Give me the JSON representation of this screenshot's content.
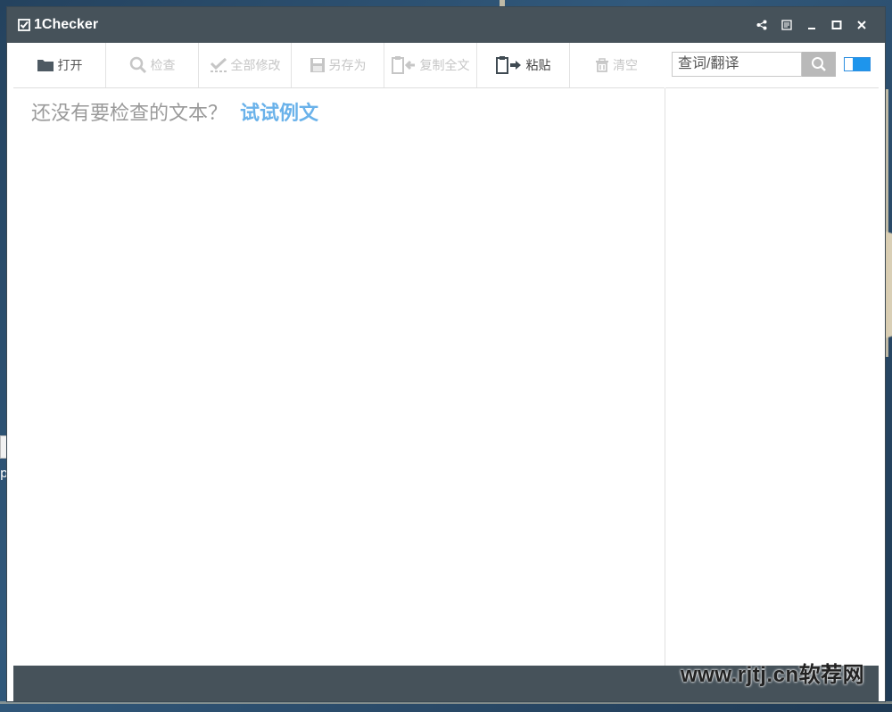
{
  "window": {
    "title": "1Checker",
    "app_icon": "checkbox-icon"
  },
  "titlebar_buttons": [
    {
      "name": "share-icon"
    },
    {
      "name": "feedback-icon"
    },
    {
      "name": "minimize-icon"
    },
    {
      "name": "maximize-icon"
    },
    {
      "name": "close-icon"
    }
  ],
  "toolbar": {
    "open": {
      "label": "打开",
      "icon": "folder-icon",
      "enabled": true
    },
    "check": {
      "label": "检查",
      "icon": "magnifier-icon",
      "enabled": false
    },
    "fix_all": {
      "label": "全部修改",
      "icon": "check-all-icon",
      "enabled": false
    },
    "save_as": {
      "label": "另存为",
      "icon": "save-icon",
      "enabled": false
    },
    "copy_all": {
      "label": "复制全文",
      "icon": "copy-icon",
      "enabled": false
    },
    "paste": {
      "label": "粘贴",
      "icon": "paste-icon",
      "enabled": true
    },
    "clear": {
      "label": "清空",
      "icon": "trash-icon",
      "enabled": false
    }
  },
  "search": {
    "placeholder": "查词/翻译",
    "value": ""
  },
  "editor": {
    "empty_message": "还没有要检查的文本？",
    "example_link": "试试例文"
  },
  "desktop": {
    "fragment_text": "p"
  },
  "watermark": "www.rjtj.cn软荐网",
  "colors": {
    "titlebar": "#46525a",
    "link": "#6ab2ea",
    "toggle": "#1e95ec"
  }
}
